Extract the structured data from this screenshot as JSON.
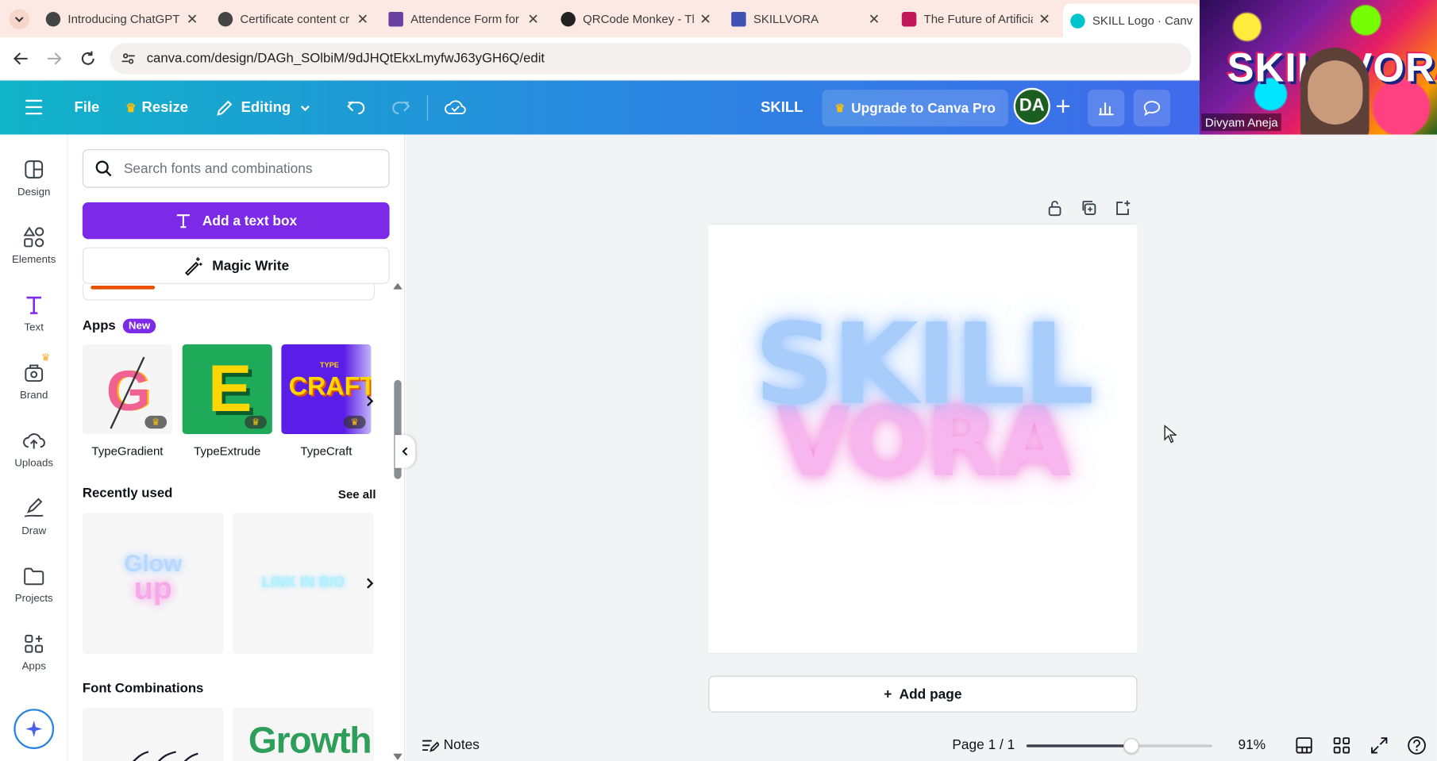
{
  "browser": {
    "tabs": [
      {
        "title": "Introducing ChatGPT",
        "favicon": "chatgpt-icon",
        "color": "#444444"
      },
      {
        "title": "Certificate content cr",
        "favicon": "chatgpt-icon",
        "color": "#444444"
      },
      {
        "title": "Attendence Form for",
        "favicon": "forms-icon",
        "color": "#6b3fa0"
      },
      {
        "title": "QRCode Monkey - Th",
        "favicon": "qrmonkey-icon",
        "color": "#222222"
      },
      {
        "title": "SKILLVORA",
        "favicon": "forms-icon",
        "color": "#3f51b5"
      },
      {
        "title": "The Future of Artificia",
        "favicon": "gamma-icon",
        "color": "#c2185b"
      },
      {
        "title": "SKILL  Logo · Canva",
        "favicon": "canva-icon",
        "color": "#00c4cc"
      }
    ],
    "url": "canva.com/design/DAGh_SOlbiM/9dJHQtEkxLmyfwJ63yGH6Q/edit"
  },
  "header": {
    "file": "File",
    "resize": "Resize",
    "editing": "Editing",
    "doc_title": "SKILL",
    "upgrade": "Upgrade to Canva Pro",
    "avatar": "DA"
  },
  "rail": {
    "items": [
      "Design",
      "Elements",
      "Text",
      "Brand",
      "Uploads",
      "Draw",
      "Projects",
      "Apps"
    ]
  },
  "panel": {
    "search_placeholder": "Search fonts and combinations",
    "add_text": "Add a text box",
    "magic_write": "Magic Write",
    "apps_heading": "Apps",
    "new_badge": "New",
    "apps": [
      {
        "name": "TypeGradient",
        "tile_text": "G"
      },
      {
        "name": "TypeExtrude",
        "tile_text": "E"
      },
      {
        "name": "TypeCraft",
        "tile_text": "CRAFT",
        "tile_sub": "TYPE"
      }
    ],
    "recent_heading": "Recently used",
    "see_all": "See all",
    "recent": [
      {
        "line1": "Glow",
        "line2": "up"
      },
      {
        "line1": "LINK IN BIO"
      }
    ],
    "font_comb_heading": "Font Combinations",
    "font_comb_sample": "Growth"
  },
  "canvas": {
    "word1": "SKILL",
    "word2": "VORA",
    "add_page": "Add page",
    "notes": "Notes",
    "page_indicator": "Page 1 / 1",
    "zoom": "91%",
    "zoom_fraction": 0.56
  },
  "webcam": {
    "name": "Divyam Aneja",
    "poster_text": "SKILLVORA"
  },
  "colors": {
    "canva_purple": "#7d2ae8",
    "header_start": "#10b4c8",
    "header_end": "#4a5ff0",
    "word1_color": "#a9cdfb",
    "word2_color": "#f7b6ee"
  }
}
